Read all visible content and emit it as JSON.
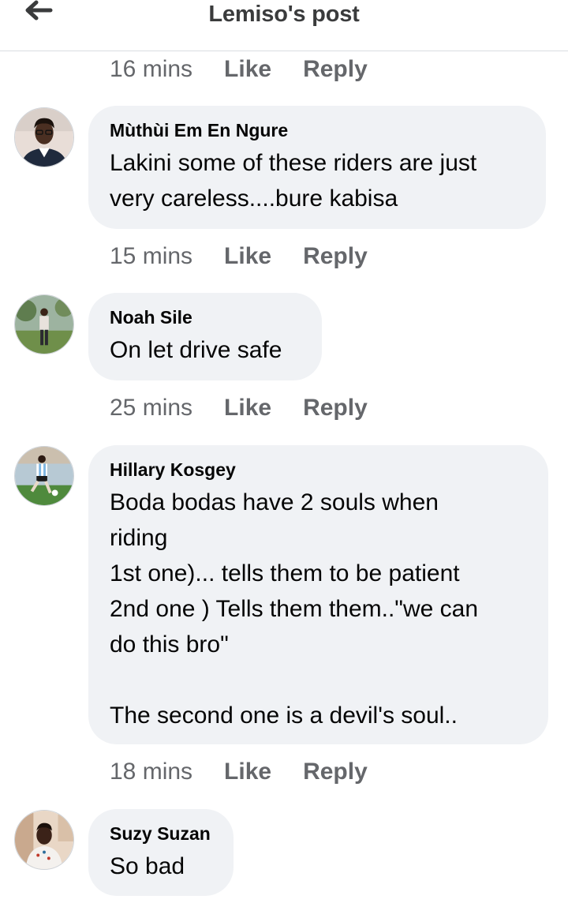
{
  "header": {
    "title": "Lemiso's post",
    "back_icon": "arrow-left-icon"
  },
  "actions": {
    "like": "Like",
    "reply": "Reply"
  },
  "top_meta": {
    "time": "16 mins"
  },
  "comments": [
    {
      "author": "Mùthùi Em En Ngure",
      "text": "Lakini some of these riders are just\nvery careless....bure kabisa",
      "time": "15 mins"
    },
    {
      "author": "Noah Sile",
      "text": "On let drive safe",
      "time": "25 mins"
    },
    {
      "author": "Hillary Kosgey",
      "text": "Boda bodas have 2 souls when\nriding\n1st one)... tells them to be patient\n2nd one ) Tells them them..\"we can\ndo this bro\"\n\nThe second one is a devil's soul..",
      "time": "18 mins"
    },
    {
      "author": "Suzy Suzan",
      "text": "So bad"
    }
  ],
  "colors": {
    "bubble_bg": "#f0f2f5",
    "meta_text": "#65676b",
    "primary_text": "#050505",
    "divider": "#dadde1"
  }
}
